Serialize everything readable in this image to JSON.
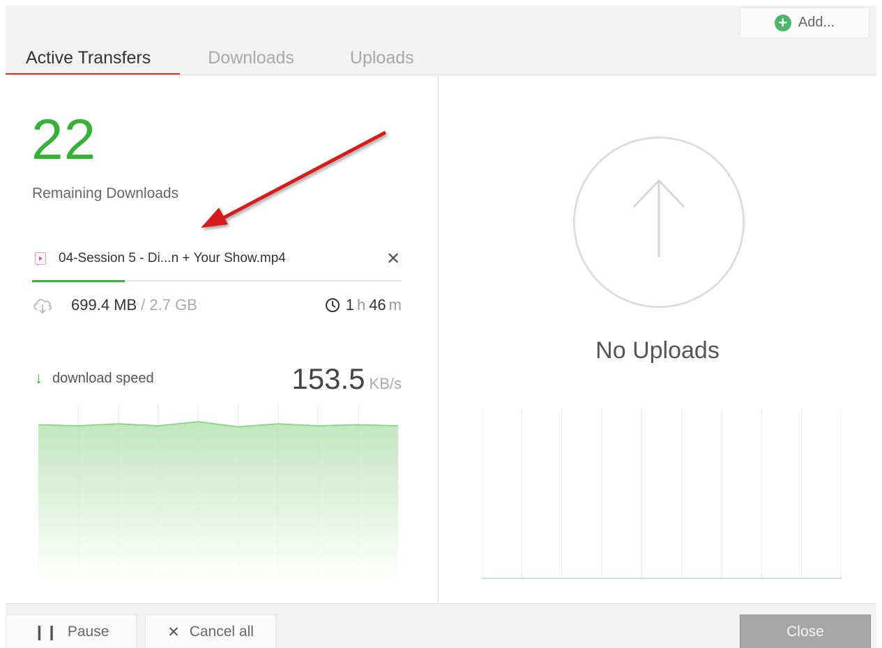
{
  "header": {
    "add_label": "Add...",
    "tabs": [
      {
        "label": "Active Transfers",
        "active": true
      },
      {
        "label": "Downloads",
        "active": false
      },
      {
        "label": "Uploads",
        "active": false
      }
    ]
  },
  "downloads": {
    "remaining_count": "22",
    "remaining_label": "Remaining Downloads",
    "file": {
      "name": "04-Session 5 - Di...n + Your Show.mp4",
      "icon": "video-file-icon",
      "progress_fraction": 0.25
    },
    "size_done": "699.4 MB",
    "size_total": "/ 2.7 GB",
    "eta": {
      "hours": "1",
      "hours_unit": "h",
      "minutes": "46",
      "minutes_unit": "m"
    },
    "speed_label": "download speed",
    "speed_value": "153.5",
    "speed_unit": "KB/s"
  },
  "chart_data": {
    "type": "area",
    "title": "",
    "xlabel": "",
    "ylabel": "",
    "series": [
      {
        "values": [
          150,
          149,
          151,
          149,
          153,
          148,
          151,
          149,
          150,
          149
        ]
      }
    ],
    "ylim": [
      0,
      170
    ],
    "grid": true,
    "color": "#8fd58f"
  },
  "uploads": {
    "empty_text": "No Uploads"
  },
  "footer": {
    "pause_label": "Pause",
    "cancel_label": "Cancel all",
    "close_label": "Close"
  },
  "colors": {
    "accent_green": "#36b336",
    "tab_underline": "#d9342b",
    "annotation_arrow": "#d61f1f"
  }
}
